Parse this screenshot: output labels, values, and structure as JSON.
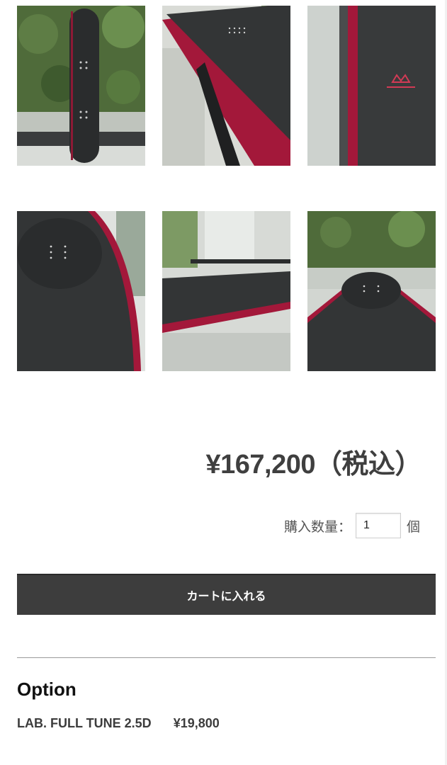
{
  "gallery": {
    "images": [
      {
        "alt": "snowboard-full-view-photo"
      },
      {
        "alt": "snowboard-nose-angle-photo"
      },
      {
        "alt": "snowboard-sidewall-logo-photo"
      },
      {
        "alt": "snowboard-tail-closeup-photo"
      },
      {
        "alt": "snowboard-base-edge-photo"
      },
      {
        "alt": "snowboard-tail-window-photo"
      }
    ],
    "colors": {
      "board": "#2f3132",
      "edge": "#a3183a",
      "foliage": "#4f6b3a",
      "window": "#e6e9e6"
    }
  },
  "product": {
    "price": "¥167,200（税込）",
    "quantity_label": "購入数量：",
    "quantity_value": "1",
    "quantity_unit": "個",
    "cart_button": "カートに入れる"
  },
  "options": {
    "title": "Option",
    "items": [
      {
        "name": "LAB. FULL TUNE 2.5D",
        "price": "¥19,800"
      }
    ]
  }
}
